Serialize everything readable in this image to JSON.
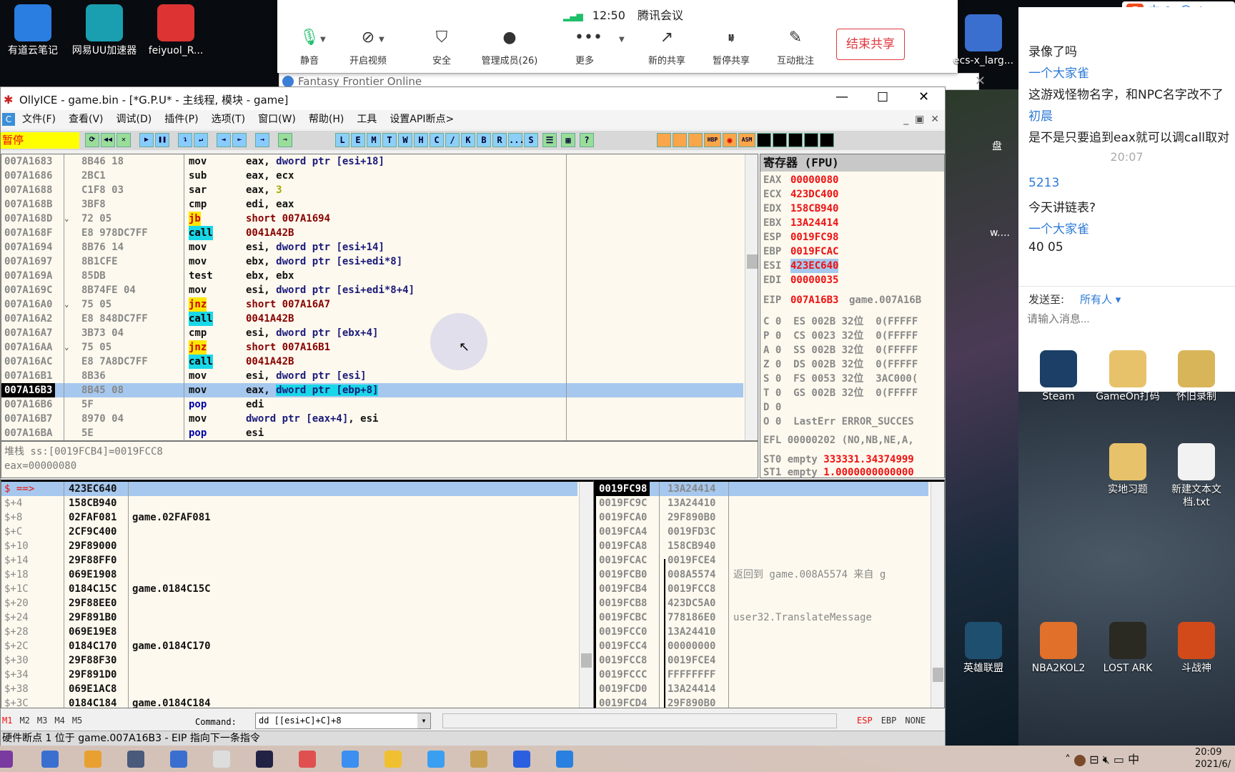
{
  "desktop": {
    "top_icons": [
      {
        "label": "有道云笔记",
        "color": "#2a7de1"
      },
      {
        "label": "网易UU加速器",
        "color": "#1a9fb0"
      },
      {
        "label": "feiyuol_R...",
        "color": "#d33"
      }
    ],
    "right_icons": [
      {
        "label": "ecs-x_larg..."
      },
      {
        "label": "Steam"
      },
      {
        "label": "GameOn打码"
      },
      {
        "label": "怀旧录制"
      },
      {
        "label": "实地习题"
      },
      {
        "label": "新建文本文档.txt"
      },
      {
        "label": "英雄联盟"
      },
      {
        "label": "NBA2KOL2"
      },
      {
        "label": "LOST ARK"
      },
      {
        "label": "斗战神"
      }
    ],
    "partial_labels": [
      "盘",
      "w...."
    ]
  },
  "meeting": {
    "time": "12:50",
    "app": "腾讯会议",
    "buttons": [
      {
        "label": "静音",
        "icon": "mic-icon"
      },
      {
        "label": "开启视频",
        "icon": "video-off-icon"
      },
      {
        "label": "安全",
        "icon": "shield-icon"
      },
      {
        "label": "管理成员(26)",
        "icon": "person-icon"
      },
      {
        "label": "更多",
        "icon": "more-icon"
      },
      {
        "label": "新的共享",
        "icon": "share-icon"
      },
      {
        "label": "暂停共享",
        "icon": "pause-icon"
      },
      {
        "label": "互动批注",
        "icon": "annotate-icon"
      }
    ],
    "end_share": "结束共享",
    "accent": "#1fbf6a",
    "end_color": "#e0383e"
  },
  "game_window": {
    "title": "Fantasy Frontier Online"
  },
  "olly": {
    "title": "OllyICE - game.bin - [*G.P.U* - 主线程, 模块 - game]",
    "menu": [
      "文件(F)",
      "查看(V)",
      "调试(D)",
      "插件(P)",
      "选项(T)",
      "窗口(W)",
      "帮助(H)",
      "工具",
      "设置API断点>"
    ],
    "status_state": "暂停",
    "toolbar_letters": [
      "L",
      "E",
      "M",
      "T",
      "W",
      "H",
      "C",
      "/",
      "K",
      "B",
      "R",
      "...",
      "S"
    ],
    "disasm": [
      {
        "addr": "007A1683",
        "hex": "8B46 18",
        "mn": "mov",
        "k": "",
        "ops": [
          [
            "eax, ",
            "r"
          ],
          [
            "dword ptr [esi+18]",
            "m"
          ]
        ]
      },
      {
        "addr": "007A1686",
        "hex": "2BC1",
        "mn": "sub",
        "k": "",
        "ops": [
          [
            "eax, ecx",
            "r"
          ]
        ]
      },
      {
        "addr": "007A1688",
        "hex": "C1F8 03",
        "mn": "sar",
        "k": "",
        "ops": [
          [
            "eax, ",
            "r"
          ],
          [
            "3",
            "y"
          ]
        ]
      },
      {
        "addr": "007A168B",
        "hex": "3BF8",
        "mn": "cmp",
        "k": "",
        "ops": [
          [
            "edi, eax",
            "r"
          ]
        ]
      },
      {
        "addr": "007A168D",
        "hex": "72 05",
        "mn": "jb",
        "k": "jmp",
        "arrow": "⌄",
        "ops": [
          [
            "short 007A1694",
            "dr"
          ]
        ]
      },
      {
        "addr": "007A168F",
        "hex": "E8 978DC7FF",
        "mn": "call",
        "k": "cll",
        "ops": [
          [
            "0041A42B",
            "dr"
          ]
        ]
      },
      {
        "addr": "007A1694",
        "hex": "8B76 14",
        "mn": "mov",
        "k": "",
        "ops": [
          [
            "esi, ",
            "r"
          ],
          [
            "dword ptr [esi+14]",
            "m"
          ]
        ]
      },
      {
        "addr": "007A1697",
        "hex": "8B1CFE",
        "mn": "mov",
        "k": "",
        "ops": [
          [
            "ebx, ",
            "r"
          ],
          [
            "dword ptr [esi+edi*8]",
            "m"
          ]
        ]
      },
      {
        "addr": "007A169A",
        "hex": "85DB",
        "mn": "test",
        "k": "",
        "ops": [
          [
            "ebx, ebx",
            "r"
          ]
        ]
      },
      {
        "addr": "007A169C",
        "hex": "8B74FE 04",
        "mn": "mov",
        "k": "",
        "ops": [
          [
            "esi, ",
            "r"
          ],
          [
            "dword ptr [esi+edi*8+4]",
            "m"
          ]
        ]
      },
      {
        "addr": "007A16A0",
        "hex": "75 05",
        "mn": "jnz",
        "k": "jmp",
        "arrow": "⌄",
        "ops": [
          [
            "short 007A16A7",
            "dr"
          ]
        ]
      },
      {
        "addr": "007A16A2",
        "hex": "E8 848DC7FF",
        "mn": "call",
        "k": "cll",
        "ops": [
          [
            "0041A42B",
            "dr"
          ]
        ]
      },
      {
        "addr": "007A16A7",
        "hex": "3B73 04",
        "mn": "cmp",
        "k": "",
        "ops": [
          [
            "esi, ",
            "r"
          ],
          [
            "dword ptr [ebx+4]",
            "m"
          ]
        ]
      },
      {
        "addr": "007A16AA",
        "hex": "75 05",
        "mn": "jnz",
        "k": "jmp",
        "arrow": "⌄",
        "ops": [
          [
            "short 007A16B1",
            "dr"
          ]
        ]
      },
      {
        "addr": "007A16AC",
        "hex": "E8 7A8DC7FF",
        "mn": "call",
        "k": "cll",
        "ops": [
          [
            "0041A42B",
            "dr"
          ]
        ]
      },
      {
        "addr": "007A16B1",
        "hex": "8B36",
        "mn": "mov",
        "k": "",
        "ops": [
          [
            "esi, ",
            "r"
          ],
          [
            "dword ptr [esi]",
            "m"
          ]
        ]
      },
      {
        "addr": "007A16B3",
        "hex": "8B45 08",
        "mn": "mov",
        "k": "",
        "sel": true,
        "ops": [
          [
            "eax, ",
            "r"
          ],
          [
            "dword ptr [ebp+8]",
            "cllm"
          ]
        ]
      },
      {
        "addr": "007A16B6",
        "hex": "5F",
        "mn": "pop",
        "k": "pop",
        "ops": [
          [
            "edi",
            "r"
          ]
        ]
      },
      {
        "addr": "007A16B7",
        "hex": "8970 04",
        "mn": "mov",
        "k": "",
        "ops": [
          [
            "dword ptr [eax+4]",
            "m"
          ],
          [
            ", esi",
            "r"
          ]
        ]
      },
      {
        "addr": "007A16BA",
        "hex": "5E",
        "mn": "pop",
        "k": "pop",
        "ops": [
          [
            "esi",
            "r"
          ]
        ]
      }
    ],
    "info": [
      "堆栈 ss:[0019FCB4]=0019FCC8",
      "eax=00000080"
    ],
    "registers": {
      "header": "寄存器 (FPU)",
      "gp": [
        [
          "EAX",
          "00000080"
        ],
        [
          "ECX",
          "423DC400"
        ],
        [
          "EDX",
          "158CB940"
        ],
        [
          "EBX",
          "13A24414"
        ],
        [
          "ESP",
          "0019FC98"
        ],
        [
          "EBP",
          "0019FCAC"
        ],
        [
          "ESI",
          "423EC640"
        ],
        [
          "EDI",
          "00000035"
        ]
      ],
      "eip": [
        "EIP",
        "007A16B3",
        "game.007A16B"
      ],
      "flags": [
        "C 0  ES 002B 32位  0(FFFFF",
        "P 0  CS 0023 32位  0(FFFFF",
        "A 0  SS 002B 32位  0(FFFFF",
        "Z 0  DS 002B 32位  0(FFFFF",
        "S 0  FS 0053 32位  3AC000(",
        "T 0  GS 002B 32位  0(FFFFF",
        "D 0",
        "O 0  LastErr ERROR_SUCCES"
      ],
      "efl": "EFL 00000202 (NO,NB,NE,A,",
      "st0": [
        "ST0 empty ",
        "333331.34374999"
      ],
      "st1": [
        "ST1 empty ",
        "1.0000000000000"
      ]
    },
    "dump": [
      [
        "$ ==>",
        "423EC640",
        ""
      ],
      [
        "$+4",
        "158CB940",
        ""
      ],
      [
        "$+8",
        "02FAF081",
        "game.02FAF081"
      ],
      [
        "$+C",
        "2CF9C400",
        ""
      ],
      [
        "$+10",
        "29F89000",
        ""
      ],
      [
        "$+14",
        "29F88FF0",
        ""
      ],
      [
        "$+18",
        "069E1908",
        ""
      ],
      [
        "$+1C",
        "0184C15C",
        "game.0184C15C"
      ],
      [
        "$+20",
        "29F88EE0",
        ""
      ],
      [
        "$+24",
        "29F891B0",
        ""
      ],
      [
        "$+28",
        "069E19E8",
        ""
      ],
      [
        "$+2C",
        "0184C170",
        "game.0184C170"
      ],
      [
        "$+30",
        "29F88F30",
        ""
      ],
      [
        "$+34",
        "29F891D0",
        ""
      ],
      [
        "$+38",
        "069E1AC8",
        ""
      ],
      [
        "$+3C",
        "0184C184",
        "game.0184C184"
      ]
    ],
    "stack": [
      [
        "0019FC98",
        "13A24414",
        ""
      ],
      [
        "0019FC9C",
        "13A24410",
        ""
      ],
      [
        "0019FCA0",
        "29F890B0",
        ""
      ],
      [
        "0019FCA4",
        "0019FD3C",
        ""
      ],
      [
        "0019FCA8",
        "158CB940",
        ""
      ],
      [
        "0019FCAC",
        "0019FCE4",
        ""
      ],
      [
        "0019FCB0",
        "008A5574",
        "返回到 game.008A5574 来自 g"
      ],
      [
        "0019FCB4",
        "0019FCC8",
        ""
      ],
      [
        "0019FCB8",
        "423DC5A0",
        ""
      ],
      [
        "0019FCBC",
        "778186E0",
        "user32.TranslateMessage"
      ],
      [
        "0019FCC0",
        "13A24410",
        ""
      ],
      [
        "0019FCC4",
        "00000000",
        ""
      ],
      [
        "0019FCC8",
        "0019FCE4",
        ""
      ],
      [
        "0019FCCC",
        "FFFFFFFF",
        ""
      ],
      [
        "0019FCD0",
        "13A24414",
        ""
      ],
      [
        "0019FCD4",
        "29F890B0",
        ""
      ]
    ],
    "cmd": {
      "marks": [
        "M1",
        "M2",
        "M3",
        "M4",
        "M5"
      ],
      "label": "Command:",
      "value": "dd [[esi+C]+C]+8",
      "right": [
        "ESP",
        "EBP",
        "NONE"
      ]
    },
    "statusbar": "硬件断点 1 位于 game.007A16B3 - EIP 指向下一条指令"
  },
  "chat": {
    "messages": [
      {
        "text": "录像了吗"
      },
      {
        "name": "一个大家雀",
        "text": "这游戏怪物名字，和NPC名字改不了"
      },
      {
        "name": "初晨",
        "text": "是不是只要追到eax就可以调call取对"
      },
      {
        "time": "20:07"
      },
      {
        "name": "5213",
        "text": " 今天讲链表?"
      },
      {
        "name": "一个大家雀",
        "text": "40 05"
      }
    ],
    "send_to_label": "发送至:",
    "send_to_value": "所有人",
    "placeholder": "请输入消息..."
  },
  "tray": {
    "ime": "中",
    "time": "20:09",
    "date": "2021/6/"
  }
}
